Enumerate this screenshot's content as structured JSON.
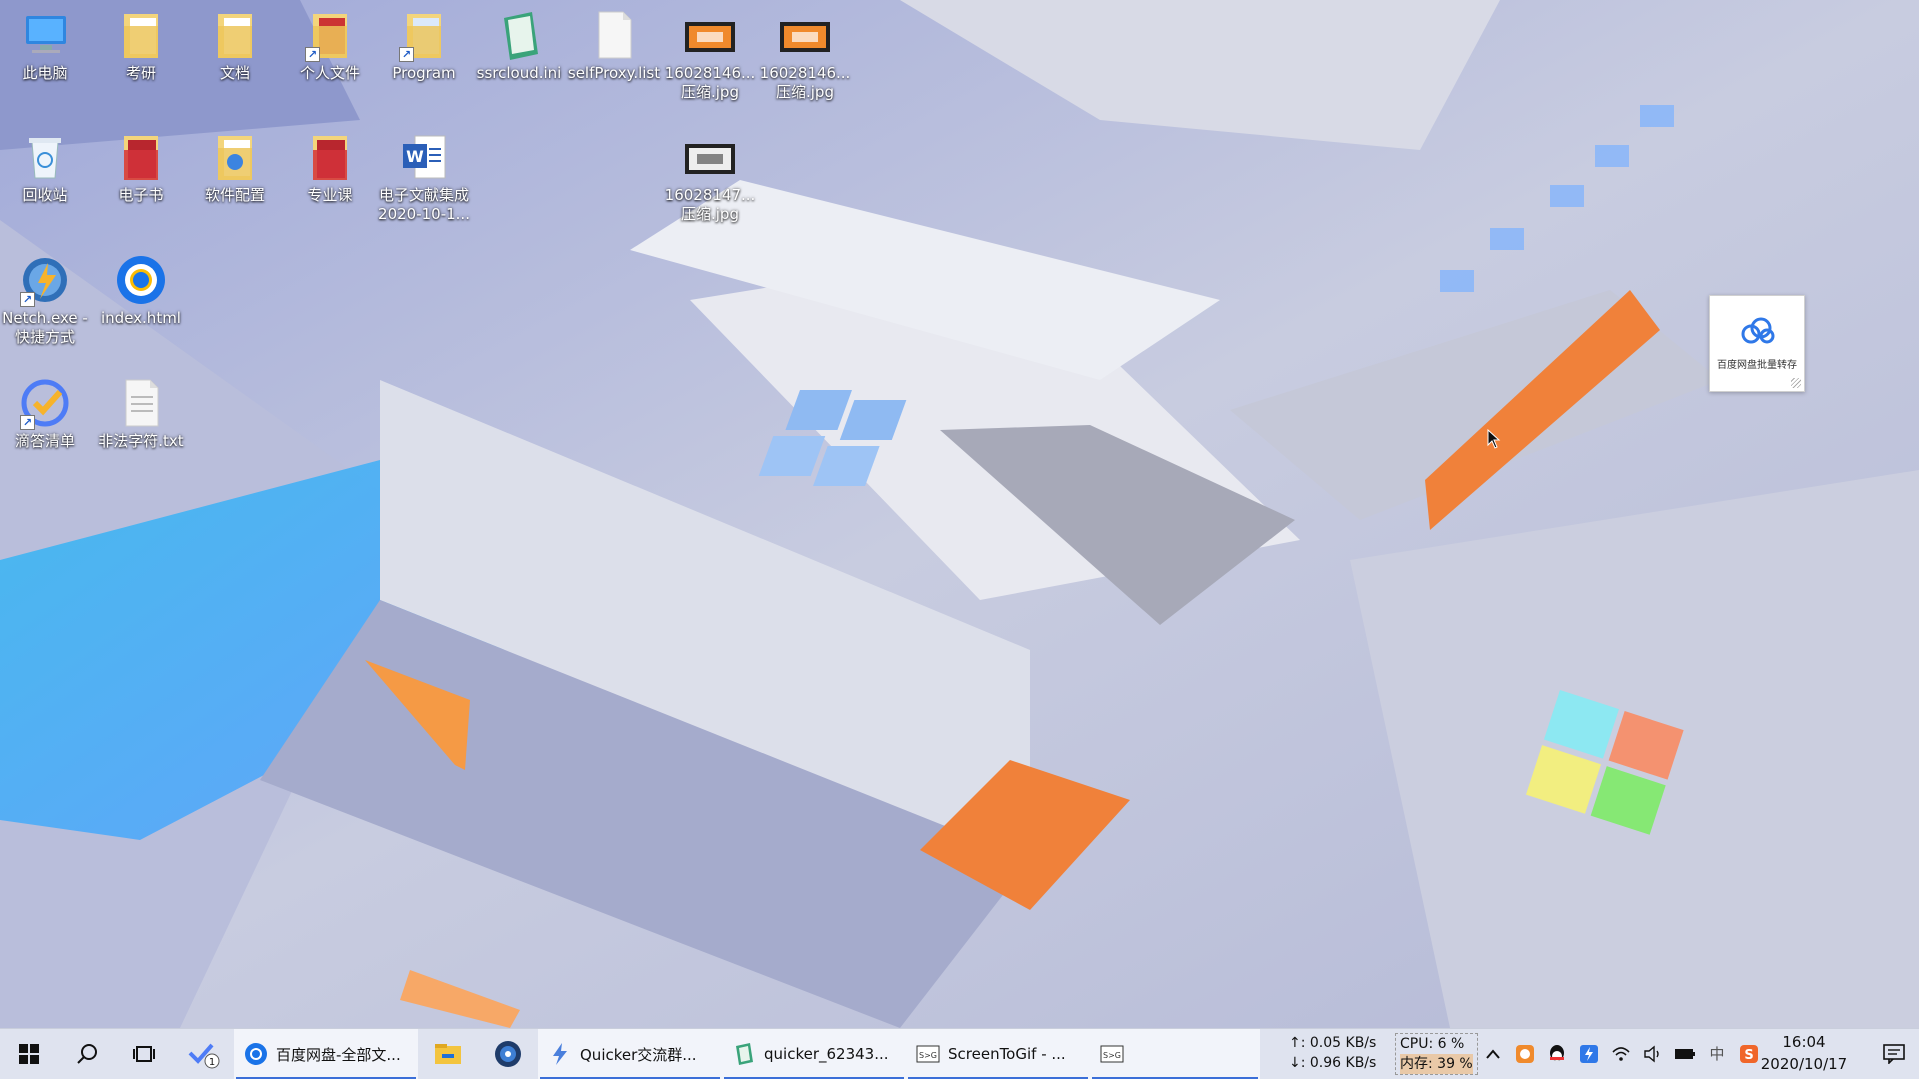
{
  "desktop": {
    "icons": [
      {
        "label": "此电脑",
        "icon": "computer-icon"
      },
      {
        "label": "考研",
        "icon": "folder-icon"
      },
      {
        "label": "文档",
        "icon": "folder-icon"
      },
      {
        "label": "个人文件",
        "icon": "folder-shortcut-icon"
      },
      {
        "label": "Program",
        "icon": "folder-shortcut-icon"
      },
      {
        "label": "ssrcloud.ini",
        "icon": "ini-file-icon"
      },
      {
        "label": "selfProxy.list",
        "icon": "blank-file-icon"
      },
      {
        "label": "16028146...\n压缩.jpg",
        "icon": "image-thumbnail-icon"
      },
      {
        "label": "16028146...\n压缩.jpg",
        "icon": "image-thumbnail-icon"
      },
      {
        "label": "回收站",
        "icon": "recycle-bin-icon"
      },
      {
        "label": "电子书",
        "icon": "folder-red-icon"
      },
      {
        "label": "软件配置",
        "icon": "folder-icon"
      },
      {
        "label": "专业课",
        "icon": "folder-red-icon"
      },
      {
        "label": "电子文献集成\n2020-10-1...",
        "icon": "word-document-icon"
      },
      {
        "label": "16028147...\n压缩.jpg",
        "icon": "image-thumbnail-icon"
      },
      {
        "label": "Netch.exe -\n快捷方式",
        "icon": "netch-app-icon"
      },
      {
        "label": "index.html",
        "icon": "chrome-icon"
      },
      {
        "label": "滴答清单",
        "icon": "ticktick-icon"
      },
      {
        "label": "非法字符.txt",
        "icon": "text-file-icon"
      }
    ],
    "widget": {
      "label": "百度网盘批量转存",
      "icon": "baidu-cloud-icon"
    }
  },
  "taskbar": {
    "start_icon": "windows-start-icon",
    "search_icon": "search-icon",
    "taskview_icon": "task-view-icon",
    "pinned_badge": "1",
    "apps": [
      {
        "name": "百度网盘-全部文...",
        "icon": "chrome-icon",
        "active": true
      },
      {
        "name": "",
        "icon": "file-explorer-icon",
        "active": false
      },
      {
        "name": "",
        "icon": "app-disc-icon",
        "active": false
      },
      {
        "name": "Quicker交流群...",
        "icon": "quicker-icon",
        "active": true
      },
      {
        "name": "quicker_62343...",
        "icon": "notepad-icon",
        "active": true
      },
      {
        "name": "ScreenToGif - ...",
        "icon": "screentogif-icon",
        "active": true
      },
      {
        "name": "",
        "icon": "screentogif-icon",
        "active": true
      }
    ],
    "net_up": "↑: 0.05 KB/s",
    "net_down": "↓: 0.96 KB/s",
    "cpu": "CPU: 6 %",
    "mem": "内存: 39 %",
    "tray_icons": [
      "chevron-up-icon",
      "orange-app-icon",
      "qq-icon",
      "quicker-tray-icon",
      "wifi-icon",
      "volume-icon",
      "battery-icon",
      "ime-icon",
      "sogou-icon"
    ],
    "ime_label": "中",
    "time": "16:04",
    "date": "2020/10/17",
    "notification_icon": "notification-icon"
  },
  "colors": {
    "accent": "#3b6fd8",
    "taskbar_bg": "#dfe3ef",
    "wallpaper_orange": "#f0813a"
  }
}
